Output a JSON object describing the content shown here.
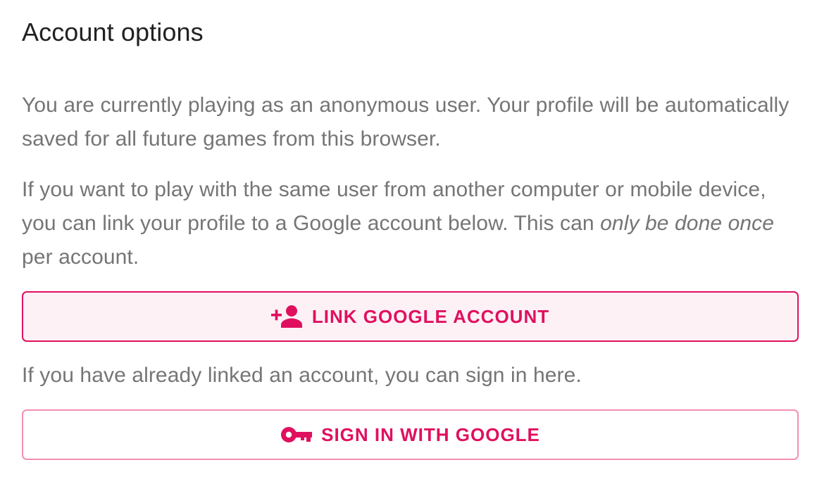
{
  "title": "Account options",
  "intro": {
    "text": "You are currently playing as an anonymous user. Your profile will be automatically saved for all future games from this browser."
  },
  "link_info": {
    "before": "If you want to play with the same user from another computer or mobile device, you can link your profile to a Google account below. This can ",
    "emphasis": "only be done once",
    "after": " per account."
  },
  "link_button": {
    "label": "LINK GOOGLE ACCOUNT",
    "icon": "person-add-icon"
  },
  "signin_info": {
    "text": "If you have already linked an account, you can sign in here."
  },
  "signin_button": {
    "label": "SIGN IN WITH GOOGLE",
    "icon": "key-icon"
  },
  "colors": {
    "accent": "#e0105f",
    "accent_light_border": "#f48fb1",
    "accent_bg": "#fdf1f5",
    "text_primary": "#212121",
    "text_secondary": "#757575"
  }
}
